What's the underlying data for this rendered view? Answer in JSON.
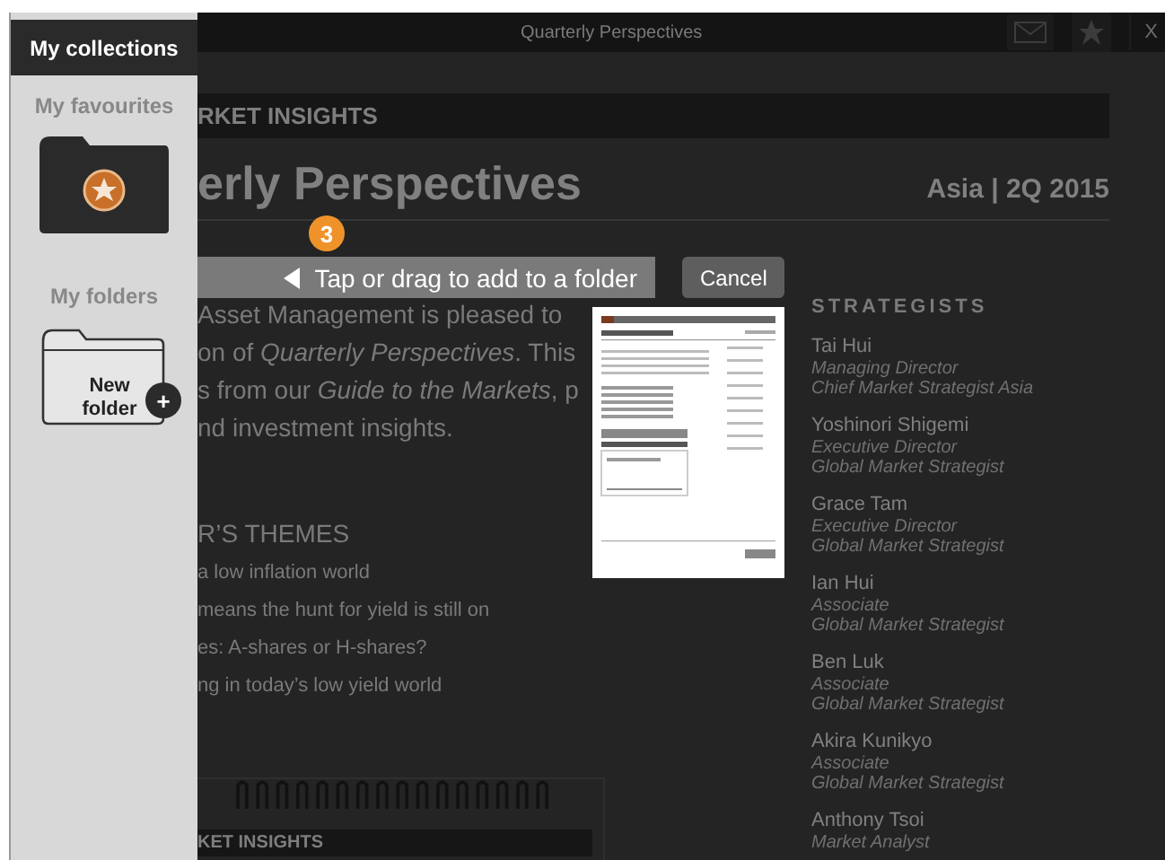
{
  "top_bar": {
    "title": "Quarterly Perspectives",
    "close_label": "X"
  },
  "sidebar": {
    "tabs": [
      {
        "label": "My collections",
        "selected": true
      }
    ],
    "sections": [
      {
        "kind": "favourites",
        "title": "My favourites"
      },
      {
        "kind": "new_folder",
        "title": "My folders",
        "folder_label": "New folder",
        "add_label": "+"
      }
    ]
  },
  "document": {
    "band": "RKET INSIGHTS",
    "title": "erly Perspectives",
    "region": "Asia | 2Q 2015",
    "intro": [
      "Asset Management is pleased to",
      "on of *Quarterly Perspectives*. This",
      "s from our *Guide to the Markets*, p",
      "nd investment insights."
    ],
    "themes_heading": "R’S THEMES",
    "themes": [
      "a low inflation world",
      "means the hunt for yield is still on",
      "es: A-shares or H-shares?",
      "ng in today’s low yield world"
    ],
    "strategists_heading": "STRATEGISTS",
    "strategists": [
      {
        "name": "Tai Hui",
        "roles": [
          "Managing Director",
          "Chief Market Strategist Asia"
        ]
      },
      {
        "name": "Yoshinori Shigemi",
        "roles": [
          "Executive Director",
          "Global Market Strategist"
        ]
      },
      {
        "name": "Grace Tam",
        "roles": [
          "Executive Director",
          "Global Market Strategist"
        ]
      },
      {
        "name": "Ian Hui",
        "roles": [
          "Associate",
          "Global Market Strategist"
        ]
      },
      {
        "name": "Ben Luk",
        "roles": [
          "Associate",
          "Global Market Strategist"
        ]
      },
      {
        "name": "Akira Kunikyo",
        "roles": [
          "Associate",
          "Global Market Strategist"
        ]
      },
      {
        "name": "Anthony Tsoi",
        "roles": [
          "Market Analyst"
        ]
      }
    ],
    "next_card_band": "KET INSIGHTS"
  },
  "drag_hint": {
    "text": "Tap or drag to add to a folder",
    "cancel": "Cancel",
    "step": "3"
  }
}
